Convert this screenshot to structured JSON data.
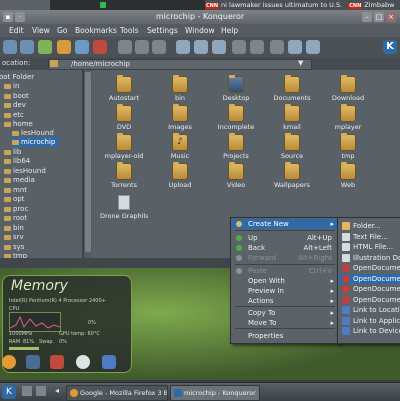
{
  "top_strip": {
    "news_badge": "CNN",
    "news_text": "ni lawmaker issues ultimatum to U.S.",
    "news_badge2": "CNN",
    "news_text2": "Zimbabw"
  },
  "window": {
    "title": "microchip - Konqueror"
  },
  "menu": [
    "Edit",
    "View",
    "Go",
    "Bookmarks",
    "Tools",
    "Settings",
    "Window",
    "Help"
  ],
  "location": {
    "label": "ocation:",
    "value": "/home/microchip"
  },
  "sidebar": {
    "root": "oot Folder",
    "items": [
      {
        "label": "in"
      },
      {
        "label": "boot"
      },
      {
        "label": "dev"
      },
      {
        "label": "etc"
      },
      {
        "label": "home"
      },
      {
        "label": "lesHound"
      },
      {
        "label": "microchip",
        "selected": true
      },
      {
        "label": "lib"
      },
      {
        "label": "lib64"
      },
      {
        "label": "lesHound"
      },
      {
        "label": "media"
      },
      {
        "label": "mnt"
      },
      {
        "label": "opt"
      },
      {
        "label": "proc"
      },
      {
        "label": "root"
      },
      {
        "label": "bin"
      },
      {
        "label": "srv"
      },
      {
        "label": "sys"
      },
      {
        "label": "tmp"
      }
    ]
  },
  "files": [
    {
      "label": "Autostart",
      "kind": "folder"
    },
    {
      "label": "bin",
      "kind": "folder"
    },
    {
      "label": "Desktop",
      "kind": "desktop"
    },
    {
      "label": "Documents",
      "kind": "folder"
    },
    {
      "label": "Download",
      "kind": "folder"
    },
    {
      "label": "DVD",
      "kind": "folder"
    },
    {
      "label": "Images",
      "kind": "folder"
    },
    {
      "label": "Incomplete",
      "kind": "folder"
    },
    {
      "label": "kmail",
      "kind": "folder"
    },
    {
      "label": "mplayer",
      "kind": "folder"
    },
    {
      "label": "mplayer-old",
      "kind": "folder"
    },
    {
      "label": "Music",
      "kind": "music"
    },
    {
      "label": "Projects",
      "kind": "folder"
    },
    {
      "label": "Source",
      "kind": "folder"
    },
    {
      "label": "tmp",
      "kind": "folder"
    },
    {
      "label": "Torrents",
      "kind": "folder"
    },
    {
      "label": "Upload",
      "kind": "folder"
    },
    {
      "label": "Video",
      "kind": "folder"
    },
    {
      "label": "Wallpapers",
      "kind": "folder"
    },
    {
      "label": "Web",
      "kind": "folder"
    },
    {
      "label": "Drone Graphite 2.p...",
      "kind": "file"
    }
  ],
  "context_menu": {
    "items": [
      {
        "label": "Create New",
        "highlight": true,
        "submenu": true
      },
      {
        "label": "Up",
        "shortcut": "Alt+Up"
      },
      {
        "label": "Back",
        "shortcut": "Alt+Left"
      },
      {
        "label": "Forward",
        "shortcut": "Alt+Right",
        "disabled": true
      },
      {
        "label": "Paste",
        "shortcut": "Ctrl+V",
        "disabled": true
      },
      {
        "label": "Open With",
        "submenu": true
      },
      {
        "label": "Preview In",
        "submenu": true
      },
      {
        "label": "Actions",
        "submenu": true
      },
      {
        "label": "Copy To",
        "submenu": true
      },
      {
        "label": "Move To",
        "submenu": true
      },
      {
        "label": "Properties"
      }
    ]
  },
  "submenu": {
    "items": [
      {
        "label": "Folder..."
      },
      {
        "label": "Text File..."
      },
      {
        "label": "HTML File..."
      },
      {
        "label": "Illustration Doc"
      },
      {
        "label": "OpenDocument"
      },
      {
        "label": "OpenDocument",
        "highlight": true
      },
      {
        "label": "OpenDocument"
      },
      {
        "label": "OpenDocument"
      },
      {
        "label": "Link to Location"
      },
      {
        "label": "Link to Applicat"
      },
      {
        "label": "Link to Device"
      }
    ]
  },
  "memory_widget": {
    "title": "Memory",
    "processor": "Intel(R) Pentium(R) 4 Processor 2400+",
    "cpu_label": "CPU",
    "cpu_freq": "1000MHz",
    "cpu_pct": "0%",
    "ram_label": "RAM",
    "ram_pct": "81%",
    "swap_label": "Swap",
    "swap_pct": "0%",
    "temp": "GPU temp: 60°C"
  },
  "taskbar": {
    "items": [
      {
        "label": "Google - Mozilla Firefox 3 Beta 5"
      },
      {
        "label": "microchip - Konqueror",
        "active": true
      }
    ]
  }
}
